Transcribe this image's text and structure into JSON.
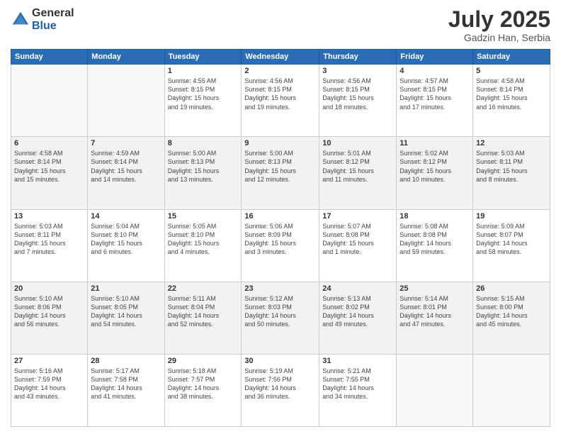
{
  "header": {
    "logo_general": "General",
    "logo_blue": "Blue",
    "title": "July 2025",
    "subtitle": "Gadzin Han, Serbia"
  },
  "weekdays": [
    "Sunday",
    "Monday",
    "Tuesday",
    "Wednesday",
    "Thursday",
    "Friday",
    "Saturday"
  ],
  "weeks": [
    [
      {
        "day": "",
        "info": ""
      },
      {
        "day": "",
        "info": ""
      },
      {
        "day": "1",
        "info": "Sunrise: 4:55 AM\nSunset: 8:15 PM\nDaylight: 15 hours\nand 19 minutes."
      },
      {
        "day": "2",
        "info": "Sunrise: 4:56 AM\nSunset: 8:15 PM\nDaylight: 15 hours\nand 19 minutes."
      },
      {
        "day": "3",
        "info": "Sunrise: 4:56 AM\nSunset: 8:15 PM\nDaylight: 15 hours\nand 18 minutes."
      },
      {
        "day": "4",
        "info": "Sunrise: 4:57 AM\nSunset: 8:15 PM\nDaylight: 15 hours\nand 17 minutes."
      },
      {
        "day": "5",
        "info": "Sunrise: 4:58 AM\nSunset: 8:14 PM\nDaylight: 15 hours\nand 16 minutes."
      }
    ],
    [
      {
        "day": "6",
        "info": "Sunrise: 4:58 AM\nSunset: 8:14 PM\nDaylight: 15 hours\nand 15 minutes."
      },
      {
        "day": "7",
        "info": "Sunrise: 4:59 AM\nSunset: 8:14 PM\nDaylight: 15 hours\nand 14 minutes."
      },
      {
        "day": "8",
        "info": "Sunrise: 5:00 AM\nSunset: 8:13 PM\nDaylight: 15 hours\nand 13 minutes."
      },
      {
        "day": "9",
        "info": "Sunrise: 5:00 AM\nSunset: 8:13 PM\nDaylight: 15 hours\nand 12 minutes."
      },
      {
        "day": "10",
        "info": "Sunrise: 5:01 AM\nSunset: 8:12 PM\nDaylight: 15 hours\nand 11 minutes."
      },
      {
        "day": "11",
        "info": "Sunrise: 5:02 AM\nSunset: 8:12 PM\nDaylight: 15 hours\nand 10 minutes."
      },
      {
        "day": "12",
        "info": "Sunrise: 5:03 AM\nSunset: 8:11 PM\nDaylight: 15 hours\nand 8 minutes."
      }
    ],
    [
      {
        "day": "13",
        "info": "Sunrise: 5:03 AM\nSunset: 8:11 PM\nDaylight: 15 hours\nand 7 minutes."
      },
      {
        "day": "14",
        "info": "Sunrise: 5:04 AM\nSunset: 8:10 PM\nDaylight: 15 hours\nand 6 minutes."
      },
      {
        "day": "15",
        "info": "Sunrise: 5:05 AM\nSunset: 8:10 PM\nDaylight: 15 hours\nand 4 minutes."
      },
      {
        "day": "16",
        "info": "Sunrise: 5:06 AM\nSunset: 8:09 PM\nDaylight: 15 hours\nand 3 minutes."
      },
      {
        "day": "17",
        "info": "Sunrise: 5:07 AM\nSunset: 8:08 PM\nDaylight: 15 hours\nand 1 minute."
      },
      {
        "day": "18",
        "info": "Sunrise: 5:08 AM\nSunset: 8:08 PM\nDaylight: 14 hours\nand 59 minutes."
      },
      {
        "day": "19",
        "info": "Sunrise: 5:09 AM\nSunset: 8:07 PM\nDaylight: 14 hours\nand 58 minutes."
      }
    ],
    [
      {
        "day": "20",
        "info": "Sunrise: 5:10 AM\nSunset: 8:06 PM\nDaylight: 14 hours\nand 56 minutes."
      },
      {
        "day": "21",
        "info": "Sunrise: 5:10 AM\nSunset: 8:05 PM\nDaylight: 14 hours\nand 54 minutes."
      },
      {
        "day": "22",
        "info": "Sunrise: 5:11 AM\nSunset: 8:04 PM\nDaylight: 14 hours\nand 52 minutes."
      },
      {
        "day": "23",
        "info": "Sunrise: 5:12 AM\nSunset: 8:03 PM\nDaylight: 14 hours\nand 50 minutes."
      },
      {
        "day": "24",
        "info": "Sunrise: 5:13 AM\nSunset: 8:02 PM\nDaylight: 14 hours\nand 49 minutes."
      },
      {
        "day": "25",
        "info": "Sunrise: 5:14 AM\nSunset: 8:01 PM\nDaylight: 14 hours\nand 47 minutes."
      },
      {
        "day": "26",
        "info": "Sunrise: 5:15 AM\nSunset: 8:00 PM\nDaylight: 14 hours\nand 45 minutes."
      }
    ],
    [
      {
        "day": "27",
        "info": "Sunrise: 5:16 AM\nSunset: 7:59 PM\nDaylight: 14 hours\nand 43 minutes."
      },
      {
        "day": "28",
        "info": "Sunrise: 5:17 AM\nSunset: 7:58 PM\nDaylight: 14 hours\nand 41 minutes."
      },
      {
        "day": "29",
        "info": "Sunrise: 5:18 AM\nSunset: 7:57 PM\nDaylight: 14 hours\nand 38 minutes."
      },
      {
        "day": "30",
        "info": "Sunrise: 5:19 AM\nSunset: 7:56 PM\nDaylight: 14 hours\nand 36 minutes."
      },
      {
        "day": "31",
        "info": "Sunrise: 5:21 AM\nSunset: 7:55 PM\nDaylight: 14 hours\nand 34 minutes."
      },
      {
        "day": "",
        "info": ""
      },
      {
        "day": "",
        "info": ""
      }
    ]
  ]
}
